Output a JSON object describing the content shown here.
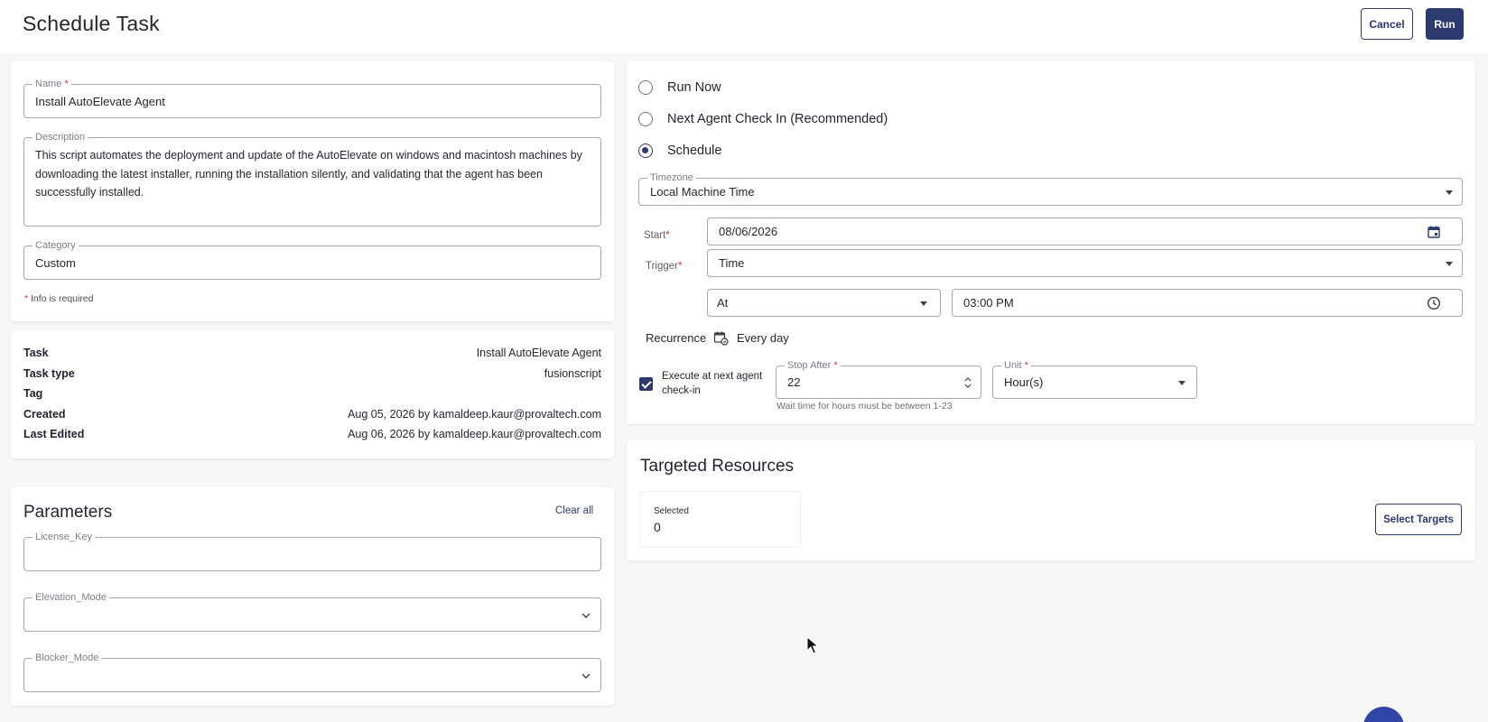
{
  "header": {
    "title": "Schedule Task",
    "cancel_label": "Cancel",
    "run_label": "Run"
  },
  "details_form": {
    "name": {
      "label": "Name",
      "value": "Install AutoElevate Agent"
    },
    "description": {
      "label": "Description",
      "value": "This script automates the deployment and update of the AutoElevate on windows and macintosh machines by downloading the latest installer, running the installation silently, and validating that the agent has been successfully installed."
    },
    "category": {
      "label": "Category",
      "value": "Custom"
    },
    "required_note": "Info is required",
    "required_mark": "*"
  },
  "task_info": [
    {
      "key": "Task",
      "value": "Install AutoElevate Agent"
    },
    {
      "key": "Task type",
      "value": "fusionscript"
    },
    {
      "key": "Tag",
      "value": ""
    },
    {
      "key": "Created",
      "value": "Aug 05, 2026 by kamaldeep.kaur@provaltech.com"
    },
    {
      "key": "Last Edited",
      "value": "Aug 06, 2026 by kamaldeep.kaur@provaltech.com"
    }
  ],
  "parameters": {
    "title": "Parameters",
    "clear_all_label": "Clear all",
    "license_key": {
      "label": "License_Key",
      "value": ""
    },
    "elevation_mode": {
      "label": "Elevation_Mode",
      "value": ""
    },
    "blocker_mode": {
      "label": "Blocker_Mode",
      "value": ""
    }
  },
  "schedule": {
    "options": [
      {
        "label": "Run Now",
        "selected": false
      },
      {
        "label": "Next Agent Check In (Recommended)",
        "selected": false
      },
      {
        "label": "Schedule",
        "selected": true
      }
    ],
    "timezone": {
      "label": "Timezone",
      "value": "Local Machine Time"
    },
    "start": {
      "label": "Start",
      "value": "08/06/2026"
    },
    "trigger": {
      "label": "Trigger",
      "value": "Time"
    },
    "at": {
      "value": "At"
    },
    "time": {
      "value": "03:00 PM"
    },
    "recurrence": {
      "label": "Recurrence",
      "value": "Every day"
    },
    "execute_next_checkin": {
      "label": "Execute at next agent check-in",
      "checked": true
    },
    "stop_after": {
      "label": "Stop After",
      "value": "22"
    },
    "unit": {
      "label": "Unit",
      "value": "Hour(s)"
    },
    "helper_text": "Wait time for hours must be between 1-23"
  },
  "targeted_resources": {
    "title": "Targeted Resources",
    "selected_label": "Selected",
    "selected_count": "0",
    "select_targets_label": "Select Targets"
  },
  "colors": {
    "primary": "#2c3a70",
    "required": "#dd3333",
    "fab": "#2f45a8"
  }
}
